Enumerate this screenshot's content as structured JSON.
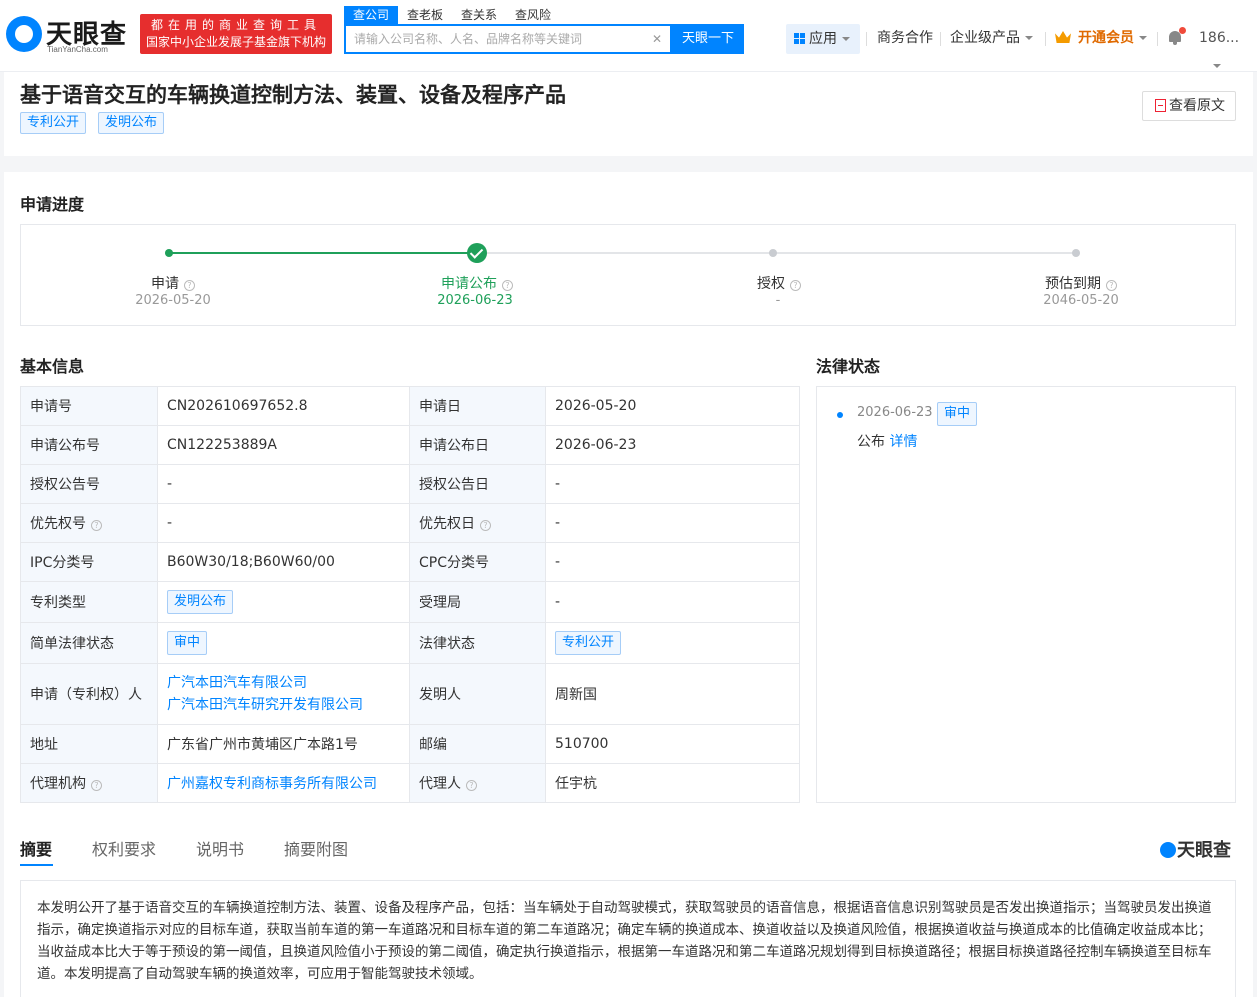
{
  "header": {
    "logo_text": "天眼查",
    "logo_sub": "TianYanCha.com",
    "slogan_line1": "都在用的商业查询工具",
    "slogan_line2": "国家中小企业发展子基金旗下机构",
    "search_tabs": [
      "查公司",
      "查老板",
      "查关系",
      "查风险"
    ],
    "search_placeholder": "请输入公司名称、人名、品牌名称等关键词",
    "search_button": "天眼一下",
    "nav_app": "应用",
    "nav_business": "商务合作",
    "nav_enterprise": "企业级产品",
    "nav_vip": "开通会员",
    "nav_user": "186..."
  },
  "patent": {
    "title": "基于语音交互的车辆换道控制方法、装置、设备及程序产品",
    "tags": [
      "专利公开",
      "发明公布"
    ],
    "view_original": "查看原文"
  },
  "progress": {
    "title": "申请进度",
    "steps": [
      {
        "label": "申请",
        "date": "2026-05-20"
      },
      {
        "label": "申请公布",
        "date": "2026-06-23"
      },
      {
        "label": "授权",
        "date": "-"
      },
      {
        "label": "预估到期",
        "date": "2046-05-20"
      }
    ]
  },
  "basic": {
    "title": "基本信息",
    "rows": [
      {
        "k1": "申请号",
        "v1": "CN202610697652.8",
        "k2": "申请日",
        "v2": "2026-05-20"
      },
      {
        "k1": "申请公布号",
        "v1": "CN122253889A",
        "k2": "申请公布日",
        "v2": "2026-06-23"
      },
      {
        "k1": "授权公告号",
        "v1": "-",
        "k2": "授权公告日",
        "v2": "-"
      },
      {
        "k1": "优先权号",
        "v1": "-",
        "k2": "优先权日",
        "v2": "-"
      },
      {
        "k1": "IPC分类号",
        "v1": "B60W30/18;B60W60/00",
        "k2": "CPC分类号",
        "v2": "-"
      },
      {
        "k1": "专利类型",
        "v1": "发明公布",
        "k2": "受理局",
        "v2": "-"
      },
      {
        "k1": "简单法律状态",
        "v1": "审中",
        "k2": "法律状态",
        "v2": "专利公开"
      },
      {
        "k1": "申请（专利权）人",
        "v1a": "广汽本田汽车有限公司",
        "v1b": "广汽本田汽车研究开发有限公司",
        "k2": "发明人",
        "v2": "周新国"
      },
      {
        "k1": "地址",
        "v1": "广东省广州市黄埔区广本路1号",
        "k2": "邮编",
        "v2": "510700"
      },
      {
        "k1": "代理机构",
        "v1": "广州嘉权专利商标事务所有限公司",
        "k2": "代理人",
        "v2": "任宇杭"
      }
    ]
  },
  "legal": {
    "title": "法律状态",
    "date": "2026-06-23",
    "tag": "审中",
    "text": "公布",
    "detail_link": "详情"
  },
  "tabs": [
    "摘要",
    "权利要求",
    "说明书",
    "摘要附图"
  ],
  "watermark": "天眼查",
  "abstract": "本发明公开了基于语音交互的车辆换道控制方法、装置、设备及程序产品，包括：当车辆处于自动驾驶模式，获取驾驶员的语音信息，根据语音信息识别驾驶员是否发出换道指示；当驾驶员发出换道指示，确定换道指示对应的目标车道，获取当前车道的第一车道路况和目标车道的第二车道路况；确定车辆的换道成本、换道收益以及换道风险值，根据换道收益与换道成本的比值确定收益成本比；当收益成本比大于等于预设的第一阈值，且换道风险值小于预设的第二阈值，确定执行换道指示，根据第一车道路况和第二车道路况规划得到目标换道路径；根据目标换道路径控制车辆换道至目标车道。本发明提高了自动驾驶车辆的换道效率，可应用于智能驾驶技术领域。",
  "colors": {
    "accent": "#0084ff",
    "brand_red": "#e62e2e",
    "success": "#1fa05a",
    "vip": "#e06a00"
  }
}
